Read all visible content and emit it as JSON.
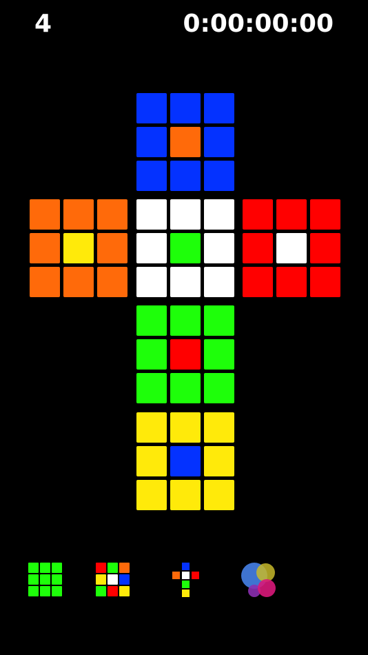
{
  "header": {
    "move_count": "4",
    "timer": "0:00:00:00"
  },
  "colors": {
    "B": "#0432FF",
    "O": "#FF6A0A",
    "W": "#FFFFFF",
    "G": "#1EFF0A",
    "R": "#FF0000",
    "Y": "#FFEA0A"
  },
  "cube": {
    "up": [
      "B",
      "B",
      "B",
      "B",
      "O",
      "B",
      "B",
      "B",
      "B"
    ],
    "left": [
      "O",
      "O",
      "O",
      "O",
      "Y",
      "O",
      "O",
      "O",
      "O"
    ],
    "front": [
      "W",
      "W",
      "W",
      "W",
      "G",
      "W",
      "W",
      "W",
      "W"
    ],
    "right": [
      "R",
      "R",
      "R",
      "R",
      "W",
      "R",
      "R",
      "R",
      "R"
    ],
    "down": [
      "G",
      "G",
      "G",
      "G",
      "R",
      "G",
      "G",
      "G",
      "G"
    ],
    "back": [
      "Y",
      "Y",
      "Y",
      "Y",
      "B",
      "Y",
      "Y",
      "Y",
      "Y"
    ]
  },
  "toolbar": {
    "solid_icon": [
      "G",
      "G",
      "G",
      "G",
      "G",
      "G",
      "G",
      "G",
      "G"
    ],
    "scramble_icon": [
      "R",
      "G",
      "O",
      "Y",
      "W",
      "B",
      "G",
      "R",
      "Y"
    ],
    "net_icon": {
      "up": "B",
      "left": "O",
      "front": "W",
      "right": "R",
      "down": "G",
      "back": "Y"
    },
    "theme_colors": [
      "#3F74D0",
      "#C7B92A",
      "#8B2FB0",
      "#D8187A"
    ]
  }
}
